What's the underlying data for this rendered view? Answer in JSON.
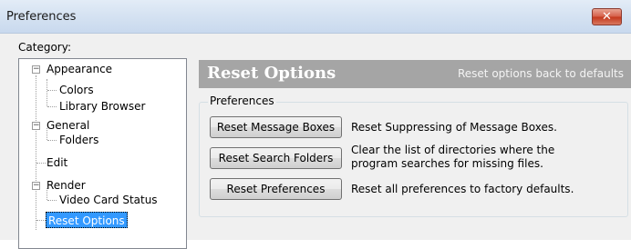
{
  "window": {
    "title": "Preferences",
    "close_glyph": "✕"
  },
  "category": {
    "label": "Category:",
    "tree": [
      {
        "label": "Appearance",
        "expanded": true,
        "children": [
          "Colors",
          "Library Browser"
        ]
      },
      {
        "label": "General",
        "expanded": true,
        "children": [
          "Folders"
        ]
      },
      {
        "label": "Edit"
      },
      {
        "label": "Render",
        "expanded": true,
        "children": [
          "Video Card Status"
        ]
      },
      {
        "label": "Reset Options",
        "selected": true
      }
    ]
  },
  "panel": {
    "title": "Reset Options",
    "subtitle": "Reset options back to defaults",
    "group_label": "Preferences",
    "actions": [
      {
        "button": "Reset Message Boxes",
        "description": "Reset Suppressing of Message Boxes."
      },
      {
        "button": "Reset Search Folders",
        "description_line1": "Clear the list of directories where the",
        "description_line2": "program searches for missing files."
      },
      {
        "button": "Reset Preferences",
        "description": "Reset all preferences to factory defaults."
      }
    ]
  },
  "icons": {
    "expander": "minus-box-icon",
    "close": "close-icon"
  },
  "colors": {
    "selection": "#3399ff",
    "banner": "#a5a5a5",
    "close": "#c4381c"
  }
}
